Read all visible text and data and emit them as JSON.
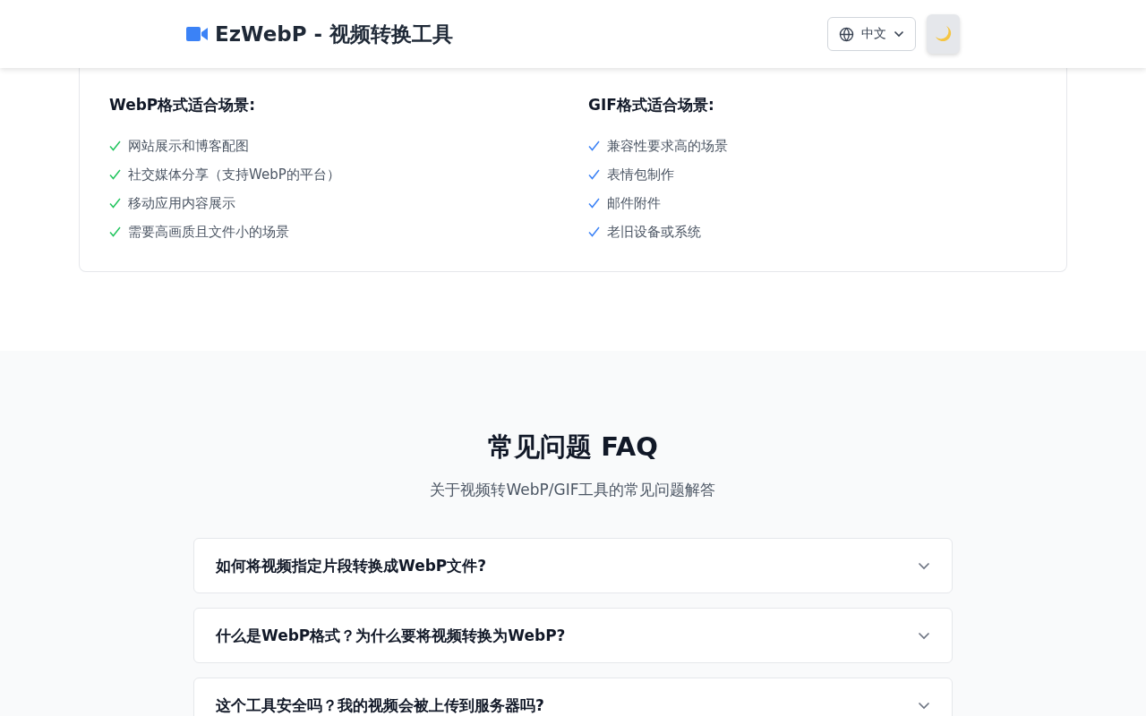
{
  "header": {
    "title": "EzWebP - 视频转换工具",
    "language": "中文"
  },
  "recommendations": [
    {
      "heading": "WebP格式适合场景:",
      "color": "#22c55e",
      "items": [
        "网站展示和博客配图",
        "社交媒体分享（支持WebP的平台）",
        "移动应用内容展示",
        "需要高画质且文件小的场景"
      ]
    },
    {
      "heading": "GIF格式适合场景:",
      "color": "#3b82f6",
      "items": [
        "兼容性要求高的场景",
        "表情包制作",
        "邮件附件",
        "老旧设备或系统"
      ]
    }
  ],
  "faq": {
    "title": "常见问题 FAQ",
    "subtitle": "关于视频转WebP/GIF工具的常见问题解答",
    "items": [
      {
        "question": "如何将视频指定片段转换成WebP文件?",
        "expanded": false
      },
      {
        "question": "什么是WebP格式？为什么要将视频转换为WebP?",
        "expanded": false
      },
      {
        "question": "这个工具安全吗？我的视频会被上传到服务器吗?",
        "expanded": false
      }
    ]
  }
}
